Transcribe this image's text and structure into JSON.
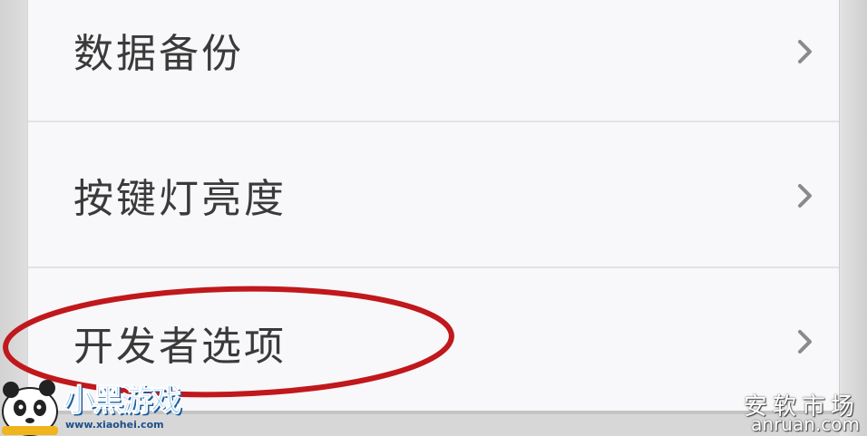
{
  "settings_list": {
    "items": [
      {
        "label": "数据备份"
      },
      {
        "label": "按键灯亮度"
      },
      {
        "label": "开发者选项"
      }
    ]
  },
  "icons": {
    "row_arrow": "chevron-right-icon",
    "highlight": "red-ellipse-annotation"
  },
  "colors": {
    "annotation": "#c0181c",
    "card_background": "#f8f7f9",
    "label_text": "#3a3a3a",
    "chevron": "#8a8a8a"
  },
  "watermarks": {
    "left_logo_text": "小黑游戏",
    "left_url": "www.xiaohei.com",
    "right_title": "安软市场",
    "right_url": "anruan.com"
  }
}
